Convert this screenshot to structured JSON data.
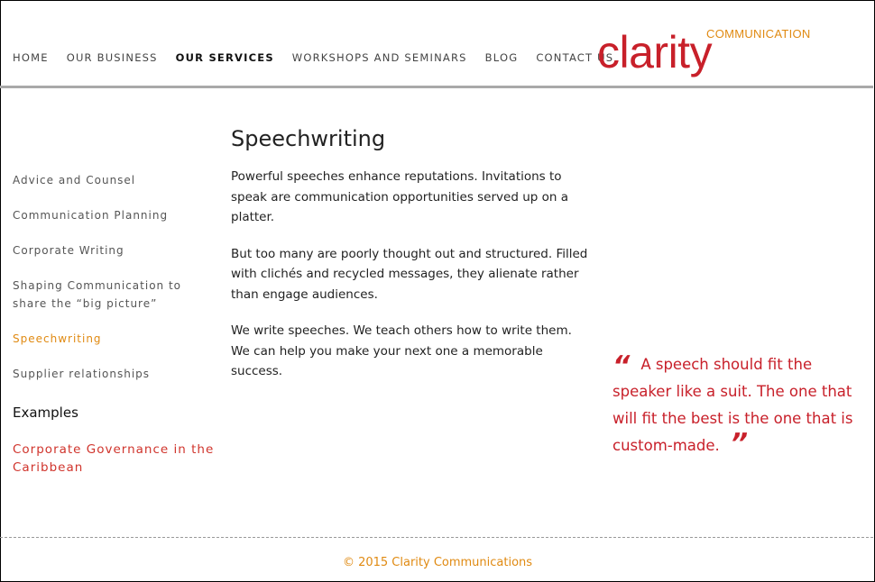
{
  "nav": {
    "items": [
      {
        "label": "HOME",
        "active": false
      },
      {
        "label": "OUR BUSINESS",
        "active": false
      },
      {
        "label": "OUR SERVICES",
        "active": true
      },
      {
        "label": "WORKSHOPS AND SEMINARS",
        "active": false
      },
      {
        "label": "BLOG",
        "active": false
      },
      {
        "label": "CONTACT US",
        "active": false
      }
    ]
  },
  "logo": {
    "word": "clarity",
    "sub": "COMMUNICATION"
  },
  "sidebar": {
    "items": [
      {
        "label": "Advice and Counsel"
      },
      {
        "label": "Communication Planning"
      },
      {
        "label": "Corporate Writing"
      },
      {
        "label": "Shaping Communication to share the “big picture”"
      },
      {
        "label": "Speechwriting",
        "active": true
      },
      {
        "label": "Supplier relationships"
      }
    ],
    "examples_heading": "Examples",
    "examples": [
      {
        "label": "Corporate Governance in the Caribbean"
      }
    ]
  },
  "main": {
    "title": "Speechwriting",
    "paragraphs": [
      "Powerful speeches enhance reputations. Invitations to speak are communication opportunities served up on a platter.",
      "But too many are poorly thought out and structured. Filled with clichés and recycled messages, they alienate rather than engage audiences.",
      "We write speeches. We teach others how to write them. We can help you make your next one a memorable success."
    ]
  },
  "quote": {
    "open_mark": "“",
    "text": "A speech should fit the speaker like a suit. The one that will fit the best is the one that is custom-made.",
    "close_mark": "”"
  },
  "footer": {
    "copyright": "© 2015 Clarity Communications"
  },
  "colors": {
    "brand_red": "#c8202a",
    "accent_orange": "#e08a12"
  }
}
